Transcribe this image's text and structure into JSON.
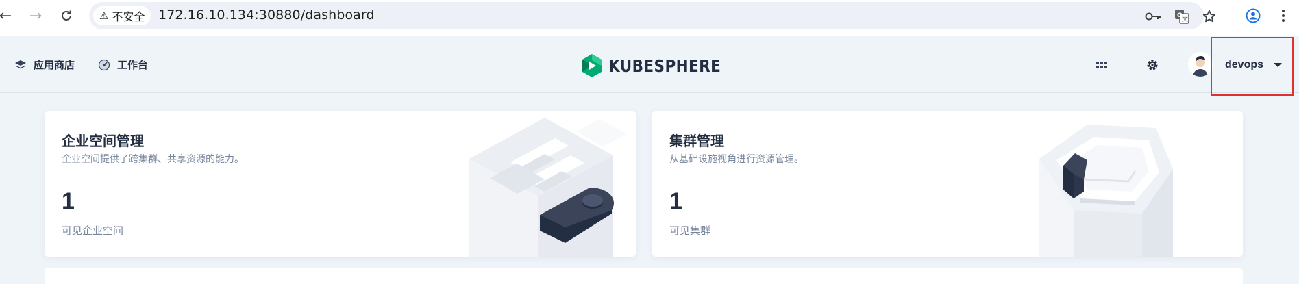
{
  "browser": {
    "security_label": "不安全",
    "url": "172.16.10.134:30880/dashboard"
  },
  "header": {
    "app_store": "应用商店",
    "workbench": "工作台",
    "logo_text": "KUBESPHERE",
    "user": {
      "name": "devops"
    }
  },
  "cards": [
    {
      "title": "企业空间管理",
      "desc": "企业空间提供了跨集群、共享资源的能力。",
      "count": "1",
      "label": "可见企业空间"
    },
    {
      "title": "集群管理",
      "desc": "从基础设施视角进行资源管理。",
      "count": "1",
      "label": "可见集群"
    }
  ],
  "colors": {
    "page_bg": "#eff4f9",
    "text_primary": "#242e42",
    "text_secondary": "#79879c",
    "brand_green": "#00aa72",
    "highlight_red": "#e03131"
  }
}
